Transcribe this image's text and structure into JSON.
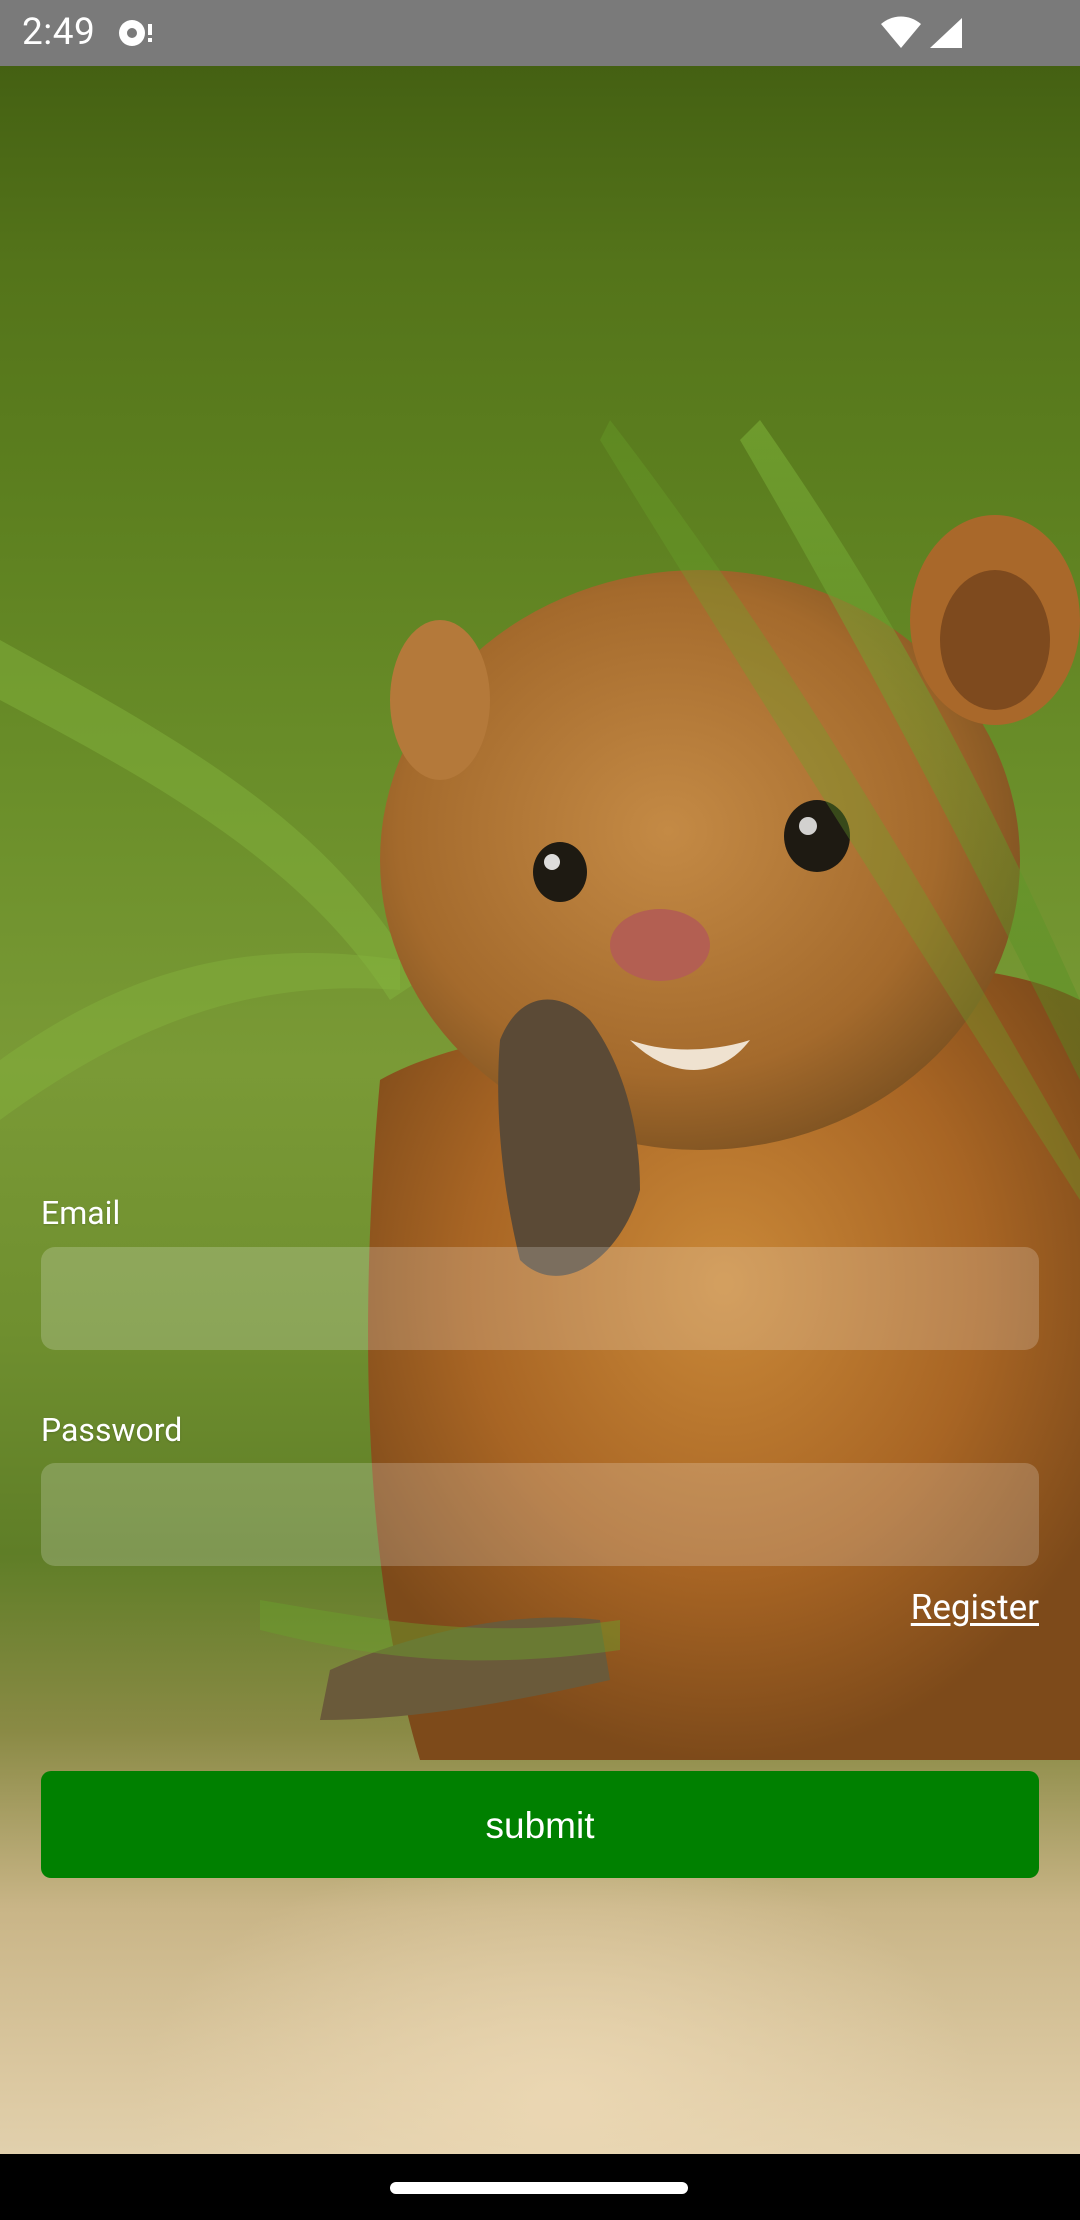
{
  "status_bar": {
    "time": "2:49",
    "icons": [
      "media-icon",
      "wifi-icon",
      "signal-icon"
    ]
  },
  "background": {
    "subject": "mongoose-photo",
    "dominant_colors": [
      "#5c7f1f",
      "#b5732a",
      "#e6d7b7"
    ]
  },
  "form": {
    "email_label": "Email",
    "email_value": "",
    "password_label": "Password",
    "password_value": "",
    "register_link": "Register",
    "submit_label": "submit"
  },
  "colors": {
    "accent": "#008000",
    "status_bar": "#7a7a7a",
    "nav_bar": "#000000"
  }
}
